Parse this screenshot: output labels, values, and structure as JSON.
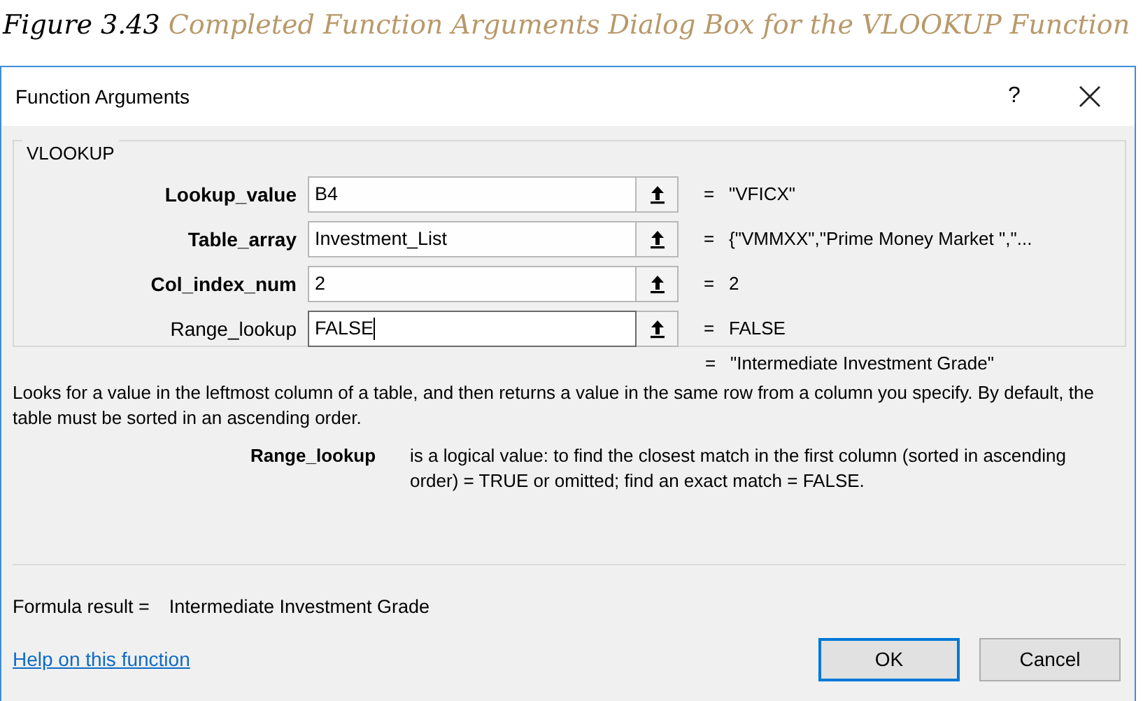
{
  "caption": {
    "number": "Figure 3.43",
    "title": "Completed Function Arguments Dialog Box for the VLOOKUP Function"
  },
  "window": {
    "title": "Function Arguments",
    "help_button": "?"
  },
  "function_name": "VLOOKUP",
  "arguments": [
    {
      "label": "Lookup_value",
      "required": true,
      "value": "B4",
      "focused": false,
      "equals": "=",
      "result": "\"VFICX\""
    },
    {
      "label": "Table_array",
      "required": true,
      "value": "Investment_List",
      "focused": false,
      "equals": "=",
      "result": "{\"VMMXX\",\"Prime Money Market \",\"..."
    },
    {
      "label": "Col_index_num",
      "required": true,
      "value": "2",
      "focused": false,
      "equals": "=",
      "result": "2"
    },
    {
      "label": "Range_lookup",
      "required": false,
      "value": "FALSE",
      "focused": true,
      "equals": "=",
      "result": "FALSE"
    }
  ],
  "overall_result": {
    "equals": "=",
    "value": "\"Intermediate Investment Grade\""
  },
  "description": "Looks for a value in the leftmost column of a table, and then returns a value in the same row from a column you specify. By default, the table must be sorted in an ascending order.",
  "argument_help": {
    "name": "Range_lookup",
    "text": "is a logical value: to find the closest match in the first column (sorted in ascending order) = TRUE or omitted; find an exact match = FALSE."
  },
  "formula_result": {
    "label": "Formula result =",
    "value": "Intermediate Investment Grade"
  },
  "help_link": "Help on this function",
  "buttons": [
    {
      "label": "OK",
      "default": true
    },
    {
      "label": "Cancel",
      "default": false
    }
  ]
}
